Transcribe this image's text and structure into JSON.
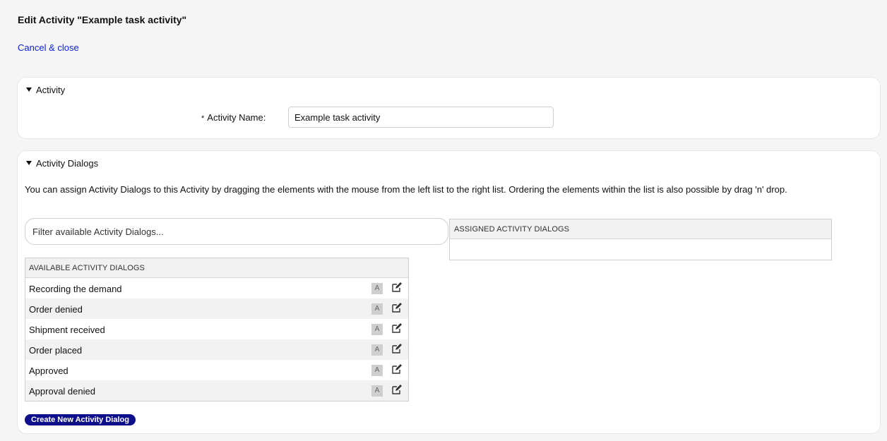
{
  "header": {
    "title": "Edit Activity \"Example task activity\"",
    "cancel_label": "Cancel & close"
  },
  "activity_panel": {
    "title": "Activity",
    "name_label": "Activity Name:",
    "required_marker": "*",
    "name_value": "Example task activity"
  },
  "dialogs_panel": {
    "title": "Activity Dialogs",
    "help_text": "You can assign Activity Dialogs to this Activity by dragging the elements with the mouse from the left list to the right list. Ordering the elements within the list is also possible by drag 'n' drop.",
    "filter_placeholder": "Filter available Activity Dialogs...",
    "assigned_header": "ASSIGNED ACTIVITY DIALOGS",
    "available_header": "AVAILABLE ACTIVITY DIALOGS",
    "available_items": [
      {
        "label": "Recording the demand",
        "badge": "A",
        "icon": "edit-icon"
      },
      {
        "label": "Order denied",
        "badge": "A",
        "icon": "edit-icon"
      },
      {
        "label": "Shipment received",
        "badge": "A",
        "icon": "edit-icon"
      },
      {
        "label": "Order placed",
        "badge": "A",
        "icon": "edit-icon"
      },
      {
        "label": "Approved",
        "badge": "A",
        "icon": "edit-icon"
      },
      {
        "label": "Approval denied",
        "badge": "A",
        "icon": "edit-icon"
      }
    ],
    "create_button_label": "Create New Activity Dialog"
  },
  "colors": {
    "link": "#0a1fd6",
    "primary_button": "#0e0f8a",
    "page_background": "#f5f5f5"
  }
}
